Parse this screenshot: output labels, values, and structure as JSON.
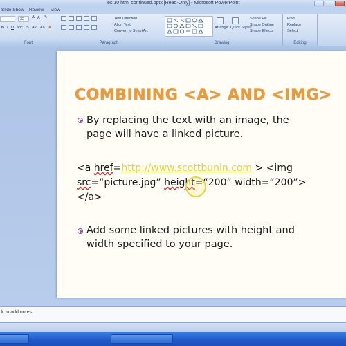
{
  "window": {
    "title": "ies 10 html continued.pptx [Read-Only] - Microsoft PowerPoint"
  },
  "ribbon": {
    "tabs": [
      "Slide Show",
      "Review",
      "View"
    ],
    "groups": [
      "Font",
      "Paragraph",
      "Drawing",
      "Editing"
    ],
    "font_size": "32",
    "tools": {
      "text_direction": "Text Direction",
      "align_text": "Align Text",
      "convert_smartart": "Convert to SmartArt",
      "arrange": "Arrange",
      "quick_styles": "Quick Styles",
      "shape_fill": "Shape Fill",
      "shape_outline": "Shape Outline",
      "shape_effects": "Shape Effects",
      "find": "Find",
      "replace": "Replace",
      "select": "Select"
    }
  },
  "slide": {
    "title": "COMBINING <A> AND <IMG>",
    "bullet1_line1": "By replacing the text with an image, the",
    "bullet1_line2": "page will have a linked picture.",
    "code": {
      "a_open": "<a ",
      "href": "href",
      "eq": "=",
      "url": "http://www.scottbunin.com",
      "gt_img": " > <img",
      "src": "src",
      "src_val": "=“picture.jpg” ",
      "height": "height",
      "height_val": "=“200” width=“200”>",
      "close": "</a>"
    },
    "bullet2_line1": "Add some linked pictures with height and",
    "bullet2_line2": "width specified to your page."
  },
  "notes": {
    "placeholder": "k to add notes"
  },
  "colors": {
    "title": "#e89a3c",
    "bullet": "#a04aa0",
    "link": "#e8d23a",
    "ribbon": "#d3e1f4"
  }
}
